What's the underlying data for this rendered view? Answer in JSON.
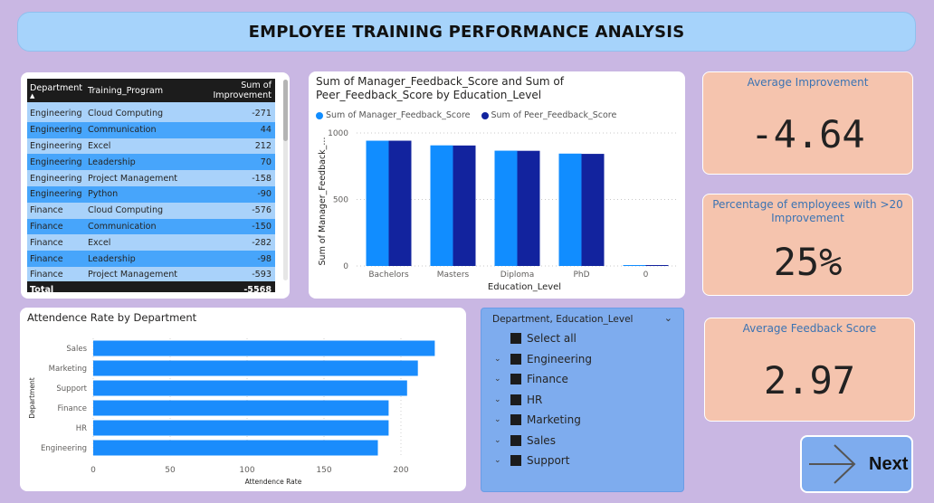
{
  "title": "EMPLOYEE TRAINING PERFORMANCE ANALYSIS",
  "table": {
    "headers": [
      "Department",
      "Training_Program",
      "Sum of Improvement"
    ],
    "rows": [
      [
        "Engineering",
        "Cloud Computing",
        "-271"
      ],
      [
        "Engineering",
        "Communication",
        "44"
      ],
      [
        "Engineering",
        "Excel",
        "212"
      ],
      [
        "Engineering",
        "Leadership",
        "70"
      ],
      [
        "Engineering",
        "Project Management",
        "-158"
      ],
      [
        "Engineering",
        "Python",
        "-90"
      ],
      [
        "Finance",
        "Cloud Computing",
        "-576"
      ],
      [
        "Finance",
        "Communication",
        "-150"
      ],
      [
        "Finance",
        "Excel",
        "-282"
      ],
      [
        "Finance",
        "Leadership",
        "-98"
      ],
      [
        "Finance",
        "Project Management",
        "-593"
      ]
    ],
    "total_label": "Total",
    "total_value": "-5568"
  },
  "kpis": {
    "avg_improvement": {
      "label": "Average Improvement",
      "value": "-4.64"
    },
    "pct_employees": {
      "label": "Percentage of employees with >20 Improvement",
      "value": "25%"
    },
    "avg_feedback": {
      "label": "Average Feedback Score",
      "value": "2.97"
    }
  },
  "slicer": {
    "title": "Department, Education_Level",
    "items": [
      "Select all",
      "Engineering",
      "Finance",
      "HR",
      "Marketing",
      "Sales",
      "Support"
    ]
  },
  "next_button": {
    "label": "Next"
  },
  "colors": {
    "series1": "#118dff",
    "series2": "#12239e",
    "bar": "#1a8cfc",
    "kpi_bg": "#f5c4ae",
    "slicer_bg": "#7eacee",
    "title_bg": "#a6d3fb"
  },
  "chart_data": [
    {
      "type": "bar",
      "title": "Sum of Manager_Feedback_Score and Sum of Peer_Feedback_Score by Education_Level",
      "xlabel": "Education_Level",
      "ylabel": "Sum of Manager_Feedback_...",
      "categories": [
        "Bachelors",
        "Masters",
        "Diploma",
        "PhD",
        "0"
      ],
      "series": [
        {
          "name": "Sum of Manager_Feedback_Score",
          "values": [
            942,
            907,
            867,
            845,
            3
          ]
        },
        {
          "name": "Sum of Peer_Feedback_Score",
          "values": [
            942,
            906,
            866,
            843,
            3
          ]
        }
      ],
      "yticks": [
        "0",
        "500",
        "1000"
      ],
      "ylim": [
        0,
        1000
      ],
      "legend": "top-left",
      "grid": true
    },
    {
      "type": "bar",
      "orientation": "horizontal",
      "title": "Attendence Rate by Department",
      "xlabel": "Attendence Rate",
      "ylabel": "Department",
      "categories": [
        "Sales",
        "Marketing",
        "Support",
        "Finance",
        "HR",
        "Engineering"
      ],
      "values": [
        222,
        211,
        204,
        192,
        192,
        185
      ],
      "xticks": [
        "0",
        "50",
        "100",
        "150",
        "200"
      ],
      "xlim": [
        0,
        230
      ],
      "grid": true
    }
  ]
}
